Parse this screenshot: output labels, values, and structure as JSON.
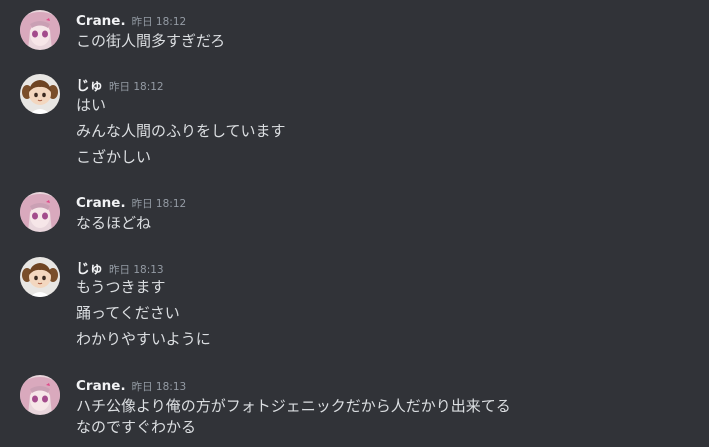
{
  "messages": [
    {
      "author": "Crane.",
      "avatar_icon": "anime-girl-pink-hair-avatar",
      "timestamp": "昨日 18:12",
      "lines": [
        "この街人間多すぎだろ"
      ]
    },
    {
      "author": "じゅ",
      "avatar_icon": "chibi-brown-twintails-avatar",
      "timestamp": "昨日 18:12",
      "lines": [
        "はい",
        "みんな人間のふりをしています",
        "こざかしい"
      ]
    },
    {
      "author": "Crane.",
      "avatar_icon": "anime-girl-pink-hair-avatar",
      "timestamp": "昨日 18:12",
      "lines": [
        "なるほどね"
      ]
    },
    {
      "author": "じゅ",
      "avatar_icon": "chibi-brown-twintails-avatar",
      "timestamp": "昨日 18:13",
      "lines": [
        "もうつきます",
        "踊ってください",
        "わかりやすいように"
      ]
    },
    {
      "author": "Crane.",
      "avatar_icon": "anime-girl-pink-hair-avatar",
      "timestamp": "昨日 18:13",
      "lines": [
        "ハチ公像より俺の方がフォトジェニックだから人だかり出来てる",
        "なのですぐわかる"
      ]
    }
  ],
  "colors": {
    "background": "#313338",
    "username": "#f2f3f5",
    "timestamp": "#949ba4",
    "text": "#dbdee1"
  }
}
